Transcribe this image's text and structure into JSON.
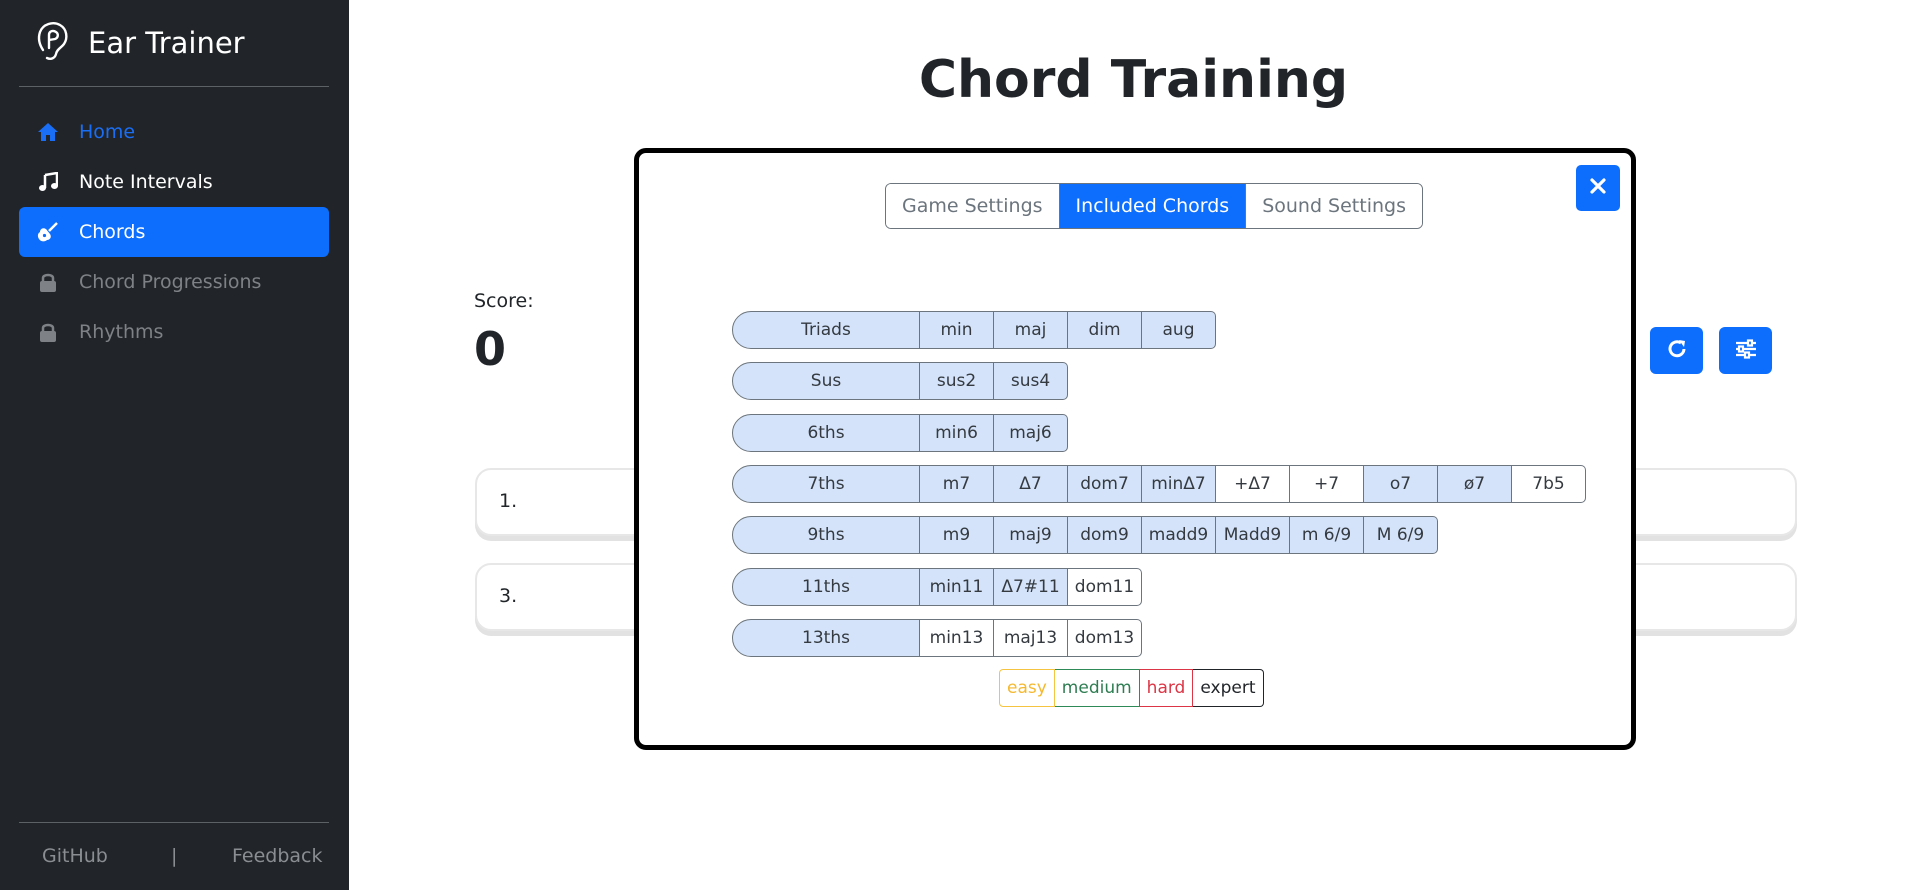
{
  "sidebar": {
    "brand_title": "Ear Trainer",
    "nav": [
      {
        "label": "Home",
        "icon": "home-icon"
      },
      {
        "label": "Note Intervals",
        "icon": "music-note-icon"
      },
      {
        "label": "Chords",
        "icon": "guitar-icon"
      },
      {
        "label": "Chord Progressions",
        "icon": "lock-icon"
      },
      {
        "label": "Rhythms",
        "icon": "lock-icon"
      }
    ],
    "footer": {
      "github": "GitHub",
      "separator": "|",
      "feedback": "Feedback"
    }
  },
  "main": {
    "title": "Chord Training",
    "score_label": "Score:",
    "score_value": "0",
    "answers": [
      "1.",
      "3."
    ]
  },
  "modal": {
    "tabs": [
      "Game Settings",
      "Included Chords",
      "Sound Settings"
    ],
    "active_tab": "Included Chords",
    "groups": [
      {
        "label": "Triads",
        "chords": [
          {
            "name": "min",
            "on": true
          },
          {
            "name": "maj",
            "on": true
          },
          {
            "name": "dim",
            "on": true
          },
          {
            "name": "aug",
            "on": true
          }
        ]
      },
      {
        "label": "Sus",
        "chords": [
          {
            "name": "sus2",
            "on": true
          },
          {
            "name": "sus4",
            "on": true
          }
        ]
      },
      {
        "label": "6ths",
        "chords": [
          {
            "name": "min6",
            "on": true
          },
          {
            "name": "maj6",
            "on": true
          }
        ]
      },
      {
        "label": "7ths",
        "chords": [
          {
            "name": "m7",
            "on": true
          },
          {
            "name": "Δ7",
            "on": true
          },
          {
            "name": "dom7",
            "on": true
          },
          {
            "name": "minΔ7",
            "on": true
          },
          {
            "name": "+Δ7",
            "on": false
          },
          {
            "name": "+7",
            "on": false
          },
          {
            "name": "o7",
            "on": true
          },
          {
            "name": "ø7",
            "on": true
          },
          {
            "name": "7b5",
            "on": false
          }
        ]
      },
      {
        "label": "9ths",
        "chords": [
          {
            "name": "m9",
            "on": true
          },
          {
            "name": "maj9",
            "on": true
          },
          {
            "name": "dom9",
            "on": true
          },
          {
            "name": "madd9",
            "on": true
          },
          {
            "name": "Madd9",
            "on": true
          },
          {
            "name": "m 6/9",
            "on": true
          },
          {
            "name": "M 6/9",
            "on": true
          }
        ]
      },
      {
        "label": "11ths",
        "chords": [
          {
            "name": "min11",
            "on": true
          },
          {
            "name": "Δ7#11",
            "on": true
          },
          {
            "name": "dom11",
            "on": false
          }
        ]
      },
      {
        "label": "13ths",
        "chords": [
          {
            "name": "min13",
            "on": false
          },
          {
            "name": "maj13",
            "on": false
          },
          {
            "name": "dom13",
            "on": false
          }
        ]
      }
    ],
    "difficulty": [
      "easy",
      "medium",
      "hard",
      "expert"
    ]
  },
  "colors": {
    "accent": "#0d6efd",
    "sidebar_bg": "#212529",
    "selected_chord_bg": "#d4e3f9"
  }
}
